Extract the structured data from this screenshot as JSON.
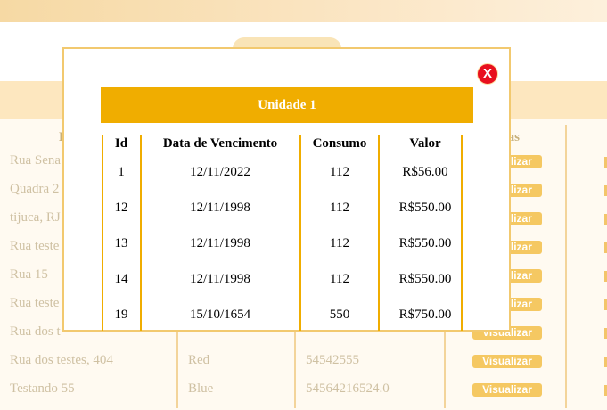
{
  "background": {
    "table_headers": [
      "E",
      "ras"
    ],
    "rows": [
      {
        "address": "Rua Sena"
      },
      {
        "address": "Quadra 2"
      },
      {
        "address": "tijuca, RJ"
      },
      {
        "address": "Rua teste"
      },
      {
        "address": "Rua 15"
      },
      {
        "address": "Rua teste"
      },
      {
        "address": "Rua dos t"
      },
      {
        "address": "Rua dos testes, 404",
        "color": "Red",
        "number": "54542555"
      },
      {
        "address": "Testando 55",
        "color": "Blue",
        "number": "54564216524.0"
      }
    ],
    "view_button_label": "Visualizar"
  },
  "modal": {
    "close_label": "X",
    "title": "Unidade 1",
    "columns": [
      "Id",
      "Data de Vencimento",
      "Consumo",
      "Valor"
    ],
    "rows": [
      {
        "id": "1",
        "due_date": "12/11/2022",
        "consumption": "112",
        "value": "R$56.00"
      },
      {
        "id": "12",
        "due_date": "12/11/1998",
        "consumption": "112",
        "value": "R$550.00"
      },
      {
        "id": "13",
        "due_date": "12/11/1998",
        "consumption": "112",
        "value": "R$550.00"
      },
      {
        "id": "14",
        "due_date": "12/11/1998",
        "consumption": "112",
        "value": "R$550.00"
      },
      {
        "id": "19",
        "due_date": "15/10/1654",
        "consumption": "550",
        "value": "R$750.00"
      }
    ]
  },
  "colors": {
    "accent": "#f0ad00",
    "close": "#e8101e",
    "button": "#f5c862"
  }
}
